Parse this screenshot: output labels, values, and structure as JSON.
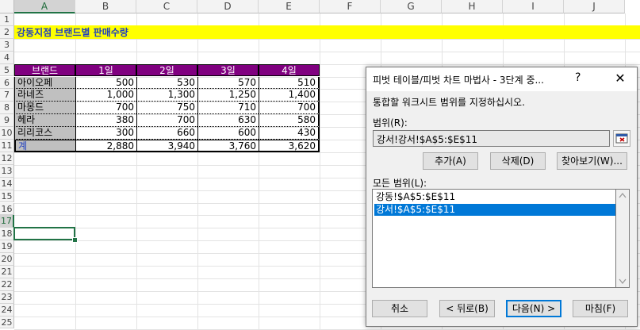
{
  "sheet": {
    "columns": [
      "A",
      "B",
      "C",
      "D",
      "E",
      "F",
      "G",
      "H",
      "I",
      "J"
    ],
    "rows": [
      "1",
      "2",
      "3",
      "4",
      "5",
      "6",
      "7",
      "8",
      "9",
      "10",
      "11",
      "12",
      "13",
      "14",
      "15",
      "16",
      "17",
      "18",
      "19",
      "20",
      "21",
      "22",
      "23",
      "24",
      "25"
    ],
    "selected_column": "A",
    "selected_row": "17",
    "title": "강동지점 브랜드별 판매수량",
    "table": {
      "headers": [
        "브랜드",
        "1일",
        "2일",
        "3일",
        "4일"
      ],
      "rows": [
        {
          "name": "아이오페",
          "values": [
            "500",
            "530",
            "570",
            "510"
          ]
        },
        {
          "name": "라네즈",
          "values": [
            "1,000",
            "1,300",
            "1,250",
            "1,400"
          ]
        },
        {
          "name": "마몽드",
          "values": [
            "700",
            "750",
            "710",
            "700"
          ]
        },
        {
          "name": "헤라",
          "values": [
            "380",
            "700",
            "630",
            "580"
          ]
        },
        {
          "name": "리리코스",
          "values": [
            "300",
            "660",
            "600",
            "430"
          ]
        }
      ],
      "total": {
        "name": "계",
        "values": [
          "2,880",
          "3,940",
          "3,760",
          "3,620"
        ]
      }
    },
    "colors": {
      "title_band": "#ffff00",
      "title_text": "#1f3fbf",
      "header_bg": "#800080",
      "name_bg": "#c0c0c0",
      "accent": "#217346"
    }
  },
  "dialog": {
    "title": "피벗 테이블/피벗 차트 마법사 - 3단계 중...",
    "help": "?",
    "close": "✕",
    "instruction": "통합할 워크시트 범위를 지정하십시오.",
    "range_label": "범위(R):",
    "range_value": "강서!강서!$A$5:$E$11",
    "add_label": "추가(A)",
    "delete_label": "삭제(D)",
    "browse_label": "찾아보기(W)...",
    "all_ranges_label": "모든 범위(L):",
    "ranges": [
      "강동!$A$5:$E$11",
      "강서!$A$5:$E$11"
    ],
    "selected_range_index": 1,
    "cancel_label": "취소",
    "back_label": "< 뒤로(B)",
    "next_label": "다음(N) >",
    "finish_label": "마침(F)",
    "collapse_icon": "range-collapse-icon",
    "focus_color": "#0078d7"
  }
}
